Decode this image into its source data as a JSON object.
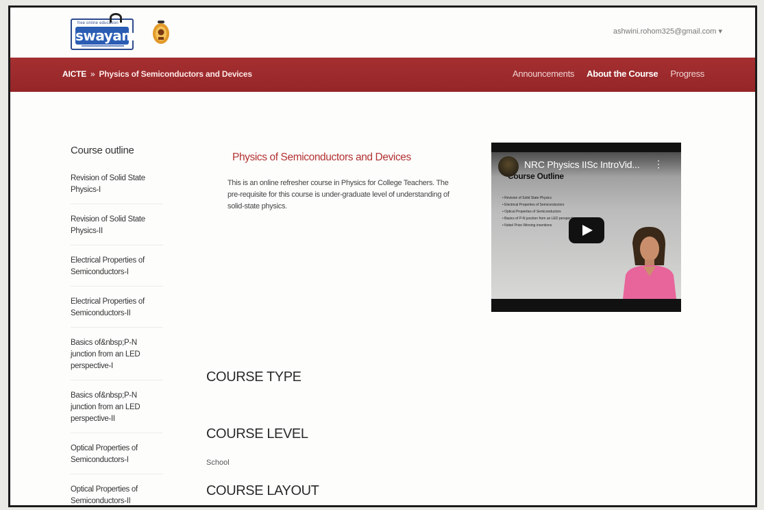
{
  "header": {
    "logo_text": "swayam",
    "logo_tagline": "free online education",
    "user_email": "ashwini.rohom325@gmail.com ▾"
  },
  "nav": {
    "crumb_org": "AICTE",
    "crumb_sep": "»",
    "crumb_course": "Physics of Semiconductors and Devices",
    "links": [
      "Announcements",
      "About the Course",
      "Progress"
    ],
    "active_link": "About the Course"
  },
  "sidebar": {
    "heading": "Course outline",
    "items": [
      "Revision of Solid State Physics-I",
      "Revision of Solid State Physics-II",
      "Electrical Properties of Semiconductors-I",
      "Electrical Properties of Semiconductors-II",
      "Basics of&nbsp;P-N junction from an LED perspective-I",
      "Basics of&nbsp;P-N junction from an LED perspective-II",
      "Optical Properties of Semiconductors-I",
      "Optical Properties of Semiconductors-II"
    ]
  },
  "main": {
    "title": "Physics of Semiconductors and Devices",
    "description": "This is an online refresher course in Physics for College Teachers. The pre-requisite for this course is under-graduate level of understanding of solid-state physics.",
    "course_type_heading": "COURSE TYPE",
    "course_level_heading": "COURSE LEVEL",
    "course_level_value": "School",
    "course_layout_heading": "COURSE LAYOUT"
  },
  "video": {
    "title": "NRC Physics IISc IntroVid...",
    "slide_heading": "Course Outline",
    "slide_bullets": [
      "• Revision of Solid State Physics",
      "• Electrical Properties of Semiconductors",
      "• Optical Properties of Semiconductors",
      "• Basics of P-N junction from an LED perspective",
      "• Nobel Prize Winning inventions"
    ]
  },
  "colors": {
    "nav_bg": "#9e2a2c",
    "title_red": "#b33232",
    "swayam_blue": "#2a5db3"
  }
}
